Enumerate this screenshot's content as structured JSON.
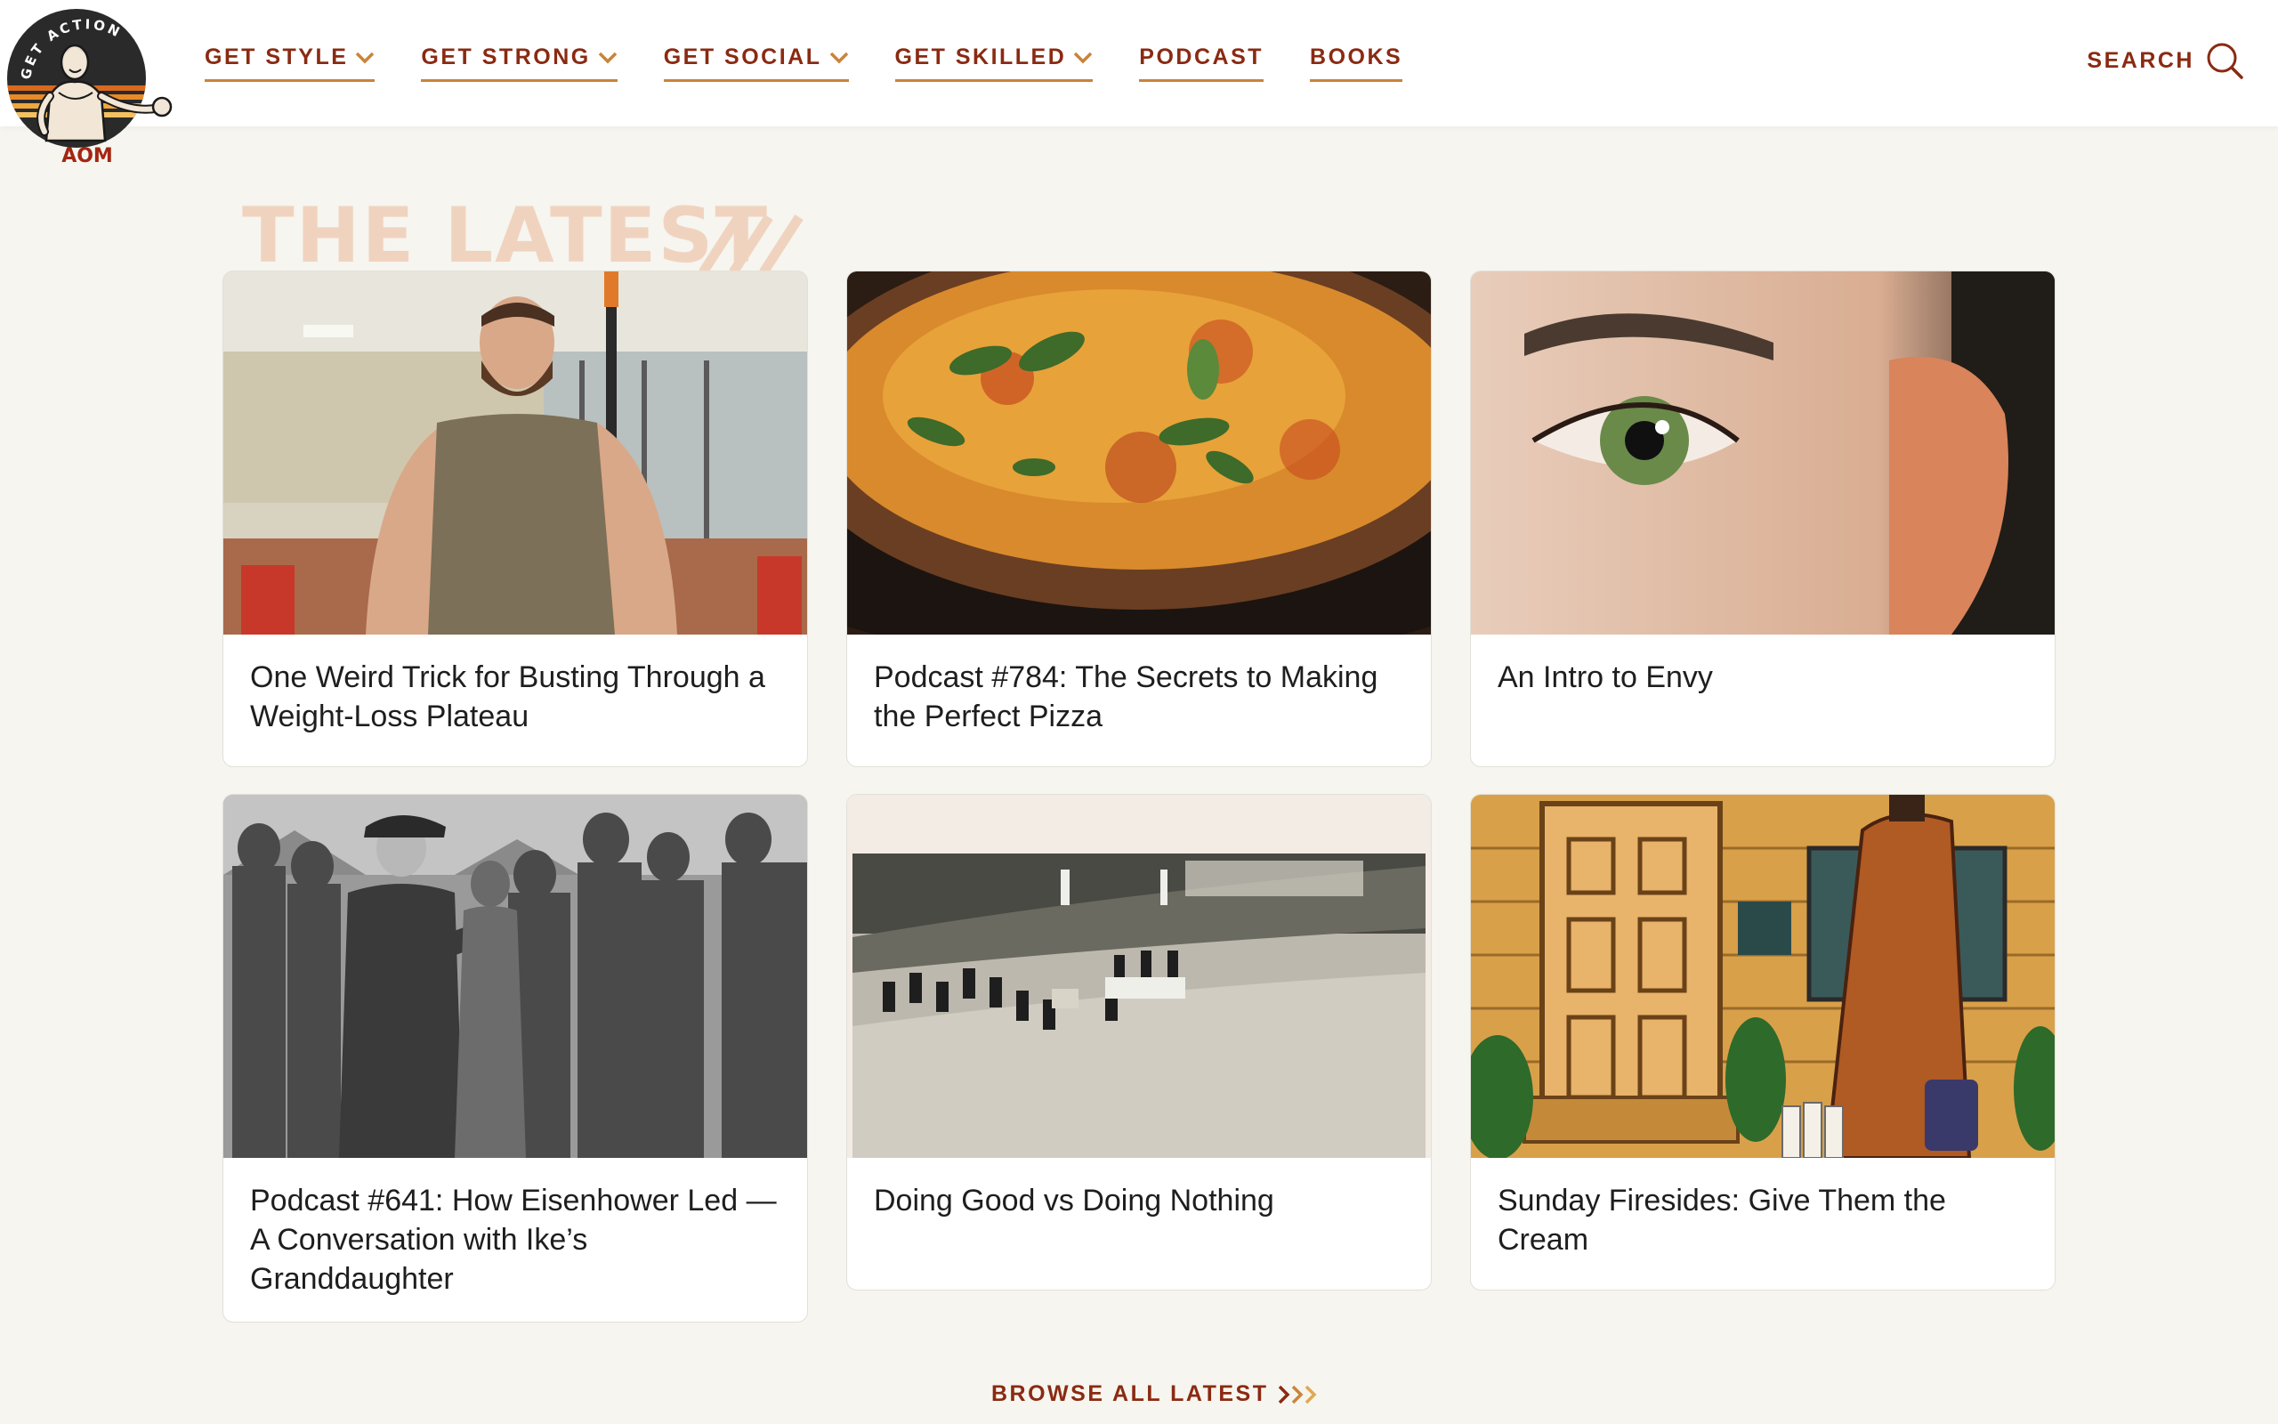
{
  "logo": {
    "ring_text": "GET ACTION",
    "wordmark": "AOM"
  },
  "nav": {
    "items": [
      {
        "label": "GET STYLE"
      },
      {
        "label": "GET STRONG"
      },
      {
        "label": "GET SOCIAL"
      },
      {
        "label": "GET SKILLED"
      },
      {
        "label": "PODCAST"
      },
      {
        "label": "BOOKS"
      }
    ],
    "search_label": "SEARCH"
  },
  "section": {
    "title": "THE LATEST"
  },
  "articles": [
    {
      "title": "One Weird Trick for Busting Through a Weight-Loss Plateau",
      "image": "man-in-weight-vest-at-gym"
    },
    {
      "title": "Podcast #784: The Secrets to Making the Perfect Pizza",
      "image": "neapolitan-pizza"
    },
    {
      "title": "An Intro to Envy",
      "image": "green-eye-closeup"
    },
    {
      "title": "Podcast #641: How Eisenhower Led — A Conversation with Ike’s Granddaughter",
      "image": "eisenhower-with-paratroopers"
    },
    {
      "title": "Doing Good vs Doing Nothing",
      "image": "vintage-funeral-procession-photo"
    },
    {
      "title": "Sunday Firesides: Give Them the Cream",
      "image": "illustrated-man-with-milk-bottles"
    }
  ],
  "browse_label": "BROWSE ALL LATEST",
  "colors": {
    "brand": "#8a2a12",
    "underline": "#c9843a",
    "title_tint": "#f0d3bf",
    "background": "#f6f5ef"
  }
}
